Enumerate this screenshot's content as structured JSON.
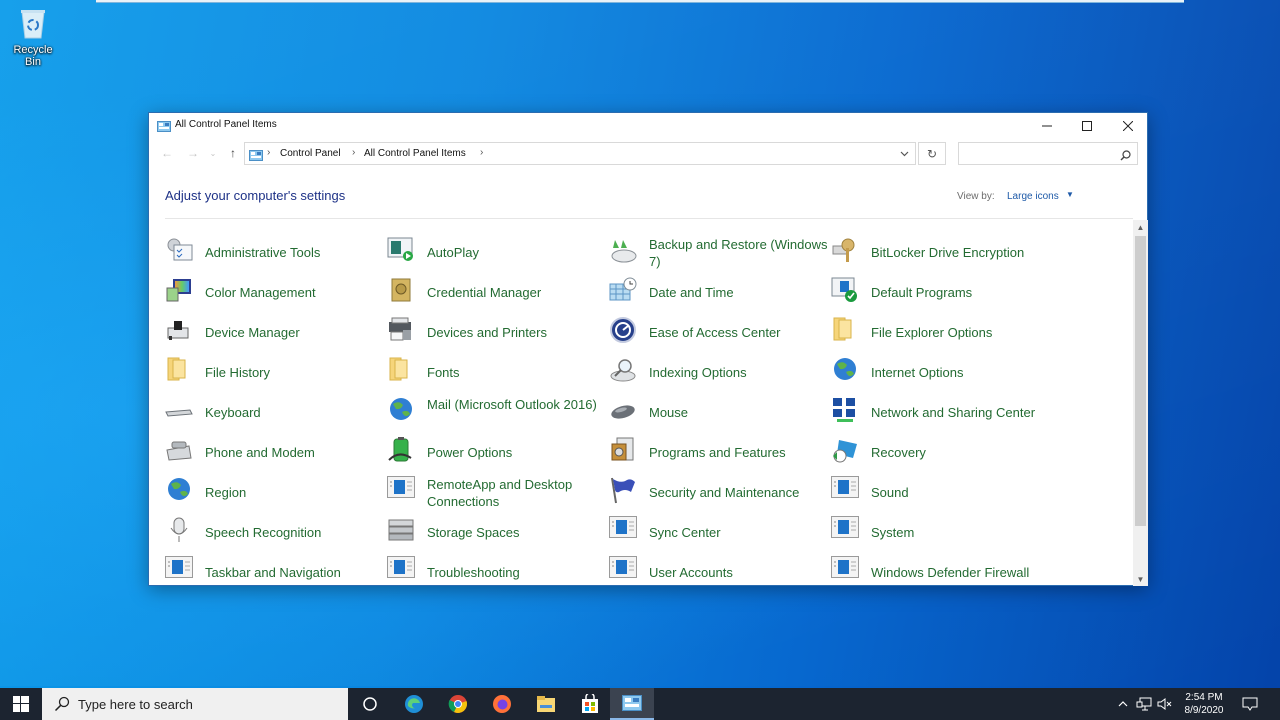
{
  "desktop": {
    "icons": [
      {
        "label": "Recycle Bin",
        "icon": "recycle-bin-icon"
      }
    ]
  },
  "window": {
    "title": "All Control Panel Items",
    "controls": {
      "minimize": "minimize",
      "maximize": "maximize",
      "close": "close"
    },
    "breadcrumb": [
      "Control Panel",
      "All Control Panel Items"
    ],
    "search_placeholder": "",
    "heading": "Adjust your computer's settings",
    "view_by_label": "View by:",
    "view_by_value": "Large icons",
    "items": [
      {
        "label": "Administrative Tools",
        "icon": "administrative-tools-icon"
      },
      {
        "label": "AutoPlay",
        "icon": "autoplay-icon"
      },
      {
        "label": "Backup and Restore (Windows 7)",
        "icon": "backup-restore-icon"
      },
      {
        "label": "BitLocker Drive Encryption",
        "icon": "bitlocker-icon"
      },
      {
        "label": "Color Management",
        "icon": "color-management-icon"
      },
      {
        "label": "Credential Manager",
        "icon": "credential-manager-icon"
      },
      {
        "label": "Date and Time",
        "icon": "date-time-icon"
      },
      {
        "label": "Default Programs",
        "icon": "default-programs-icon"
      },
      {
        "label": "Device Manager",
        "icon": "device-manager-icon"
      },
      {
        "label": "Devices and Printers",
        "icon": "devices-printers-icon"
      },
      {
        "label": "Ease of Access Center",
        "icon": "ease-of-access-icon"
      },
      {
        "label": "File Explorer Options",
        "icon": "file-explorer-options-icon"
      },
      {
        "label": "File History",
        "icon": "file-history-icon"
      },
      {
        "label": "Fonts",
        "icon": "fonts-icon"
      },
      {
        "label": "Indexing Options",
        "icon": "indexing-options-icon"
      },
      {
        "label": "Internet Options",
        "icon": "internet-options-icon"
      },
      {
        "label": "Keyboard",
        "icon": "keyboard-icon"
      },
      {
        "label": "Mail (Microsoft Outlook 2016)",
        "icon": "mail-icon"
      },
      {
        "label": "Mouse",
        "icon": "mouse-icon"
      },
      {
        "label": "Network and Sharing Center",
        "icon": "network-sharing-icon"
      },
      {
        "label": "Phone and Modem",
        "icon": "phone-modem-icon"
      },
      {
        "label": "Power Options",
        "icon": "power-options-icon"
      },
      {
        "label": "Programs and Features",
        "icon": "programs-features-icon"
      },
      {
        "label": "Recovery",
        "icon": "recovery-icon"
      },
      {
        "label": "Region",
        "icon": "region-icon"
      },
      {
        "label": "RemoteApp and Desktop Connections",
        "icon": "remoteapp-icon"
      },
      {
        "label": "Security and Maintenance",
        "icon": "security-maintenance-icon"
      },
      {
        "label": "Sound",
        "icon": "sound-icon"
      },
      {
        "label": "Speech Recognition",
        "icon": "speech-recognition-icon"
      },
      {
        "label": "Storage Spaces",
        "icon": "storage-spaces-icon"
      },
      {
        "label": "Sync Center",
        "icon": "sync-center-icon"
      },
      {
        "label": "System",
        "icon": "system-icon"
      },
      {
        "label": "Taskbar and Navigation",
        "icon": "taskbar-navigation-icon"
      },
      {
        "label": "Troubleshooting",
        "icon": "troubleshooting-icon"
      },
      {
        "label": "User Accounts",
        "icon": "user-accounts-icon"
      },
      {
        "label": "Windows Defender Firewall",
        "icon": "windows-defender-firewall-icon"
      }
    ]
  },
  "taskbar": {
    "search_placeholder": "Type here to search",
    "apps": [
      "Task View",
      "Microsoft Edge",
      "Google Chrome",
      "Firefox",
      "File Explorer",
      "Microsoft Store",
      "Control Panel"
    ],
    "time": "2:54 PM",
    "date": "8/9/2020"
  },
  "colors": {
    "link_green": "#236b32",
    "heading_blue": "#1e3287",
    "taskbar_bg": "#1c2430"
  }
}
